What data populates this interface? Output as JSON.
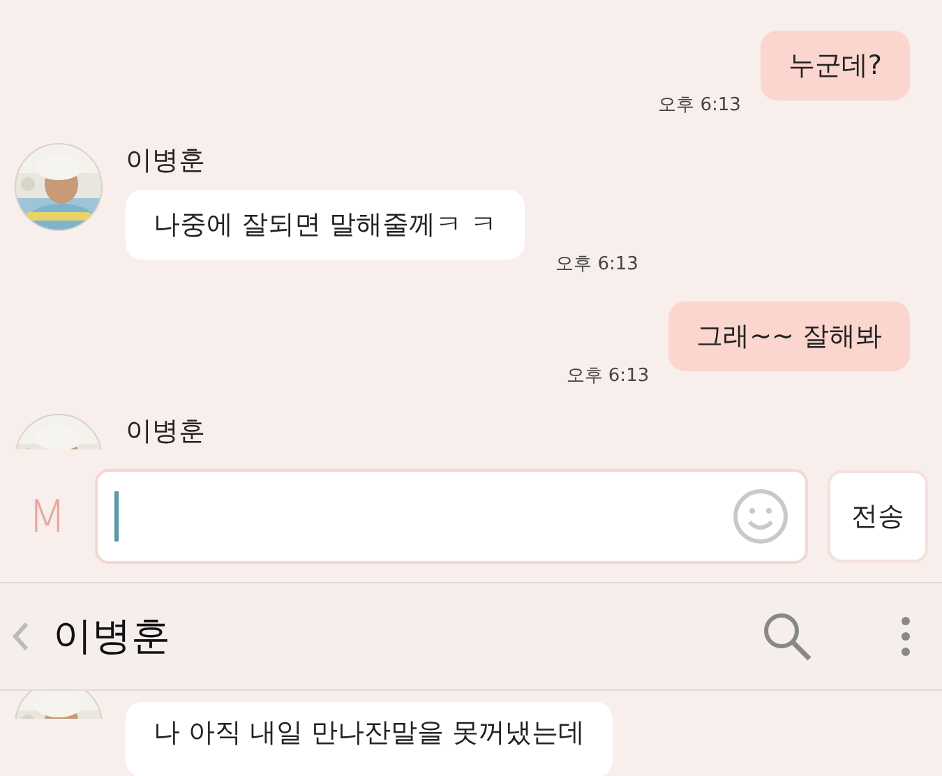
{
  "chat_top": {
    "messages": [
      {
        "kind": "sent",
        "text": "누군데?",
        "time": "오후 6:13"
      },
      {
        "kind": "received",
        "sender": "이병훈",
        "text": "나중에 잘되면 말해줄께ㅋ ㅋ",
        "time": "오후 6:13"
      },
      {
        "kind": "sent",
        "text": "그래~~ 잘해봐",
        "time": "오후 6:13"
      },
      {
        "kind": "received",
        "sender": "이병훈"
      }
    ]
  },
  "composer": {
    "brand": "M",
    "send_button": "전송"
  },
  "header": {
    "title": "이병훈"
  },
  "chat_bottom": {
    "messages": [
      {
        "kind": "received",
        "text": "나 아직 내일 만나잔말을 못꺼냈는데"
      }
    ]
  }
}
